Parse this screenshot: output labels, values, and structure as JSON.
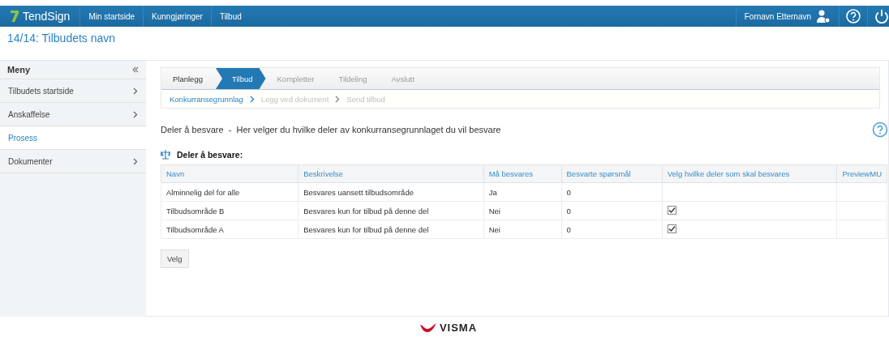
{
  "topbar": {
    "brand": "TendSign",
    "nav": [
      {
        "label": "Min startside",
        "selected": false
      },
      {
        "label": "Kunngjøringer",
        "selected": false
      },
      {
        "label": "Tilbud",
        "selected": false
      }
    ],
    "user": "Fornavn Etternavn"
  },
  "page_title": "14/14: Tilbudets navn",
  "sidebar": {
    "title": "Meny",
    "items": [
      {
        "label": "Tilbudets startside",
        "selected": false,
        "has_submenu": true
      },
      {
        "label": "Anskaffelse",
        "selected": false,
        "has_submenu": true
      },
      {
        "label": "Prosess",
        "selected": true,
        "has_submenu": false
      },
      {
        "label": "Dokumenter",
        "selected": false,
        "has_submenu": true
      }
    ]
  },
  "steps": [
    {
      "label": "Planlegg",
      "selected": false,
      "disabled": false
    },
    {
      "label": "Tilbud",
      "selected": true,
      "disabled": false
    },
    {
      "label": "Kompletter",
      "selected": false,
      "disabled": true
    },
    {
      "label": "Tildeling",
      "selected": false,
      "disabled": true
    },
    {
      "label": "Avslutt",
      "selected": false,
      "disabled": true
    }
  ],
  "substeps": [
    {
      "label": "Konkurransegrunnlag",
      "selected": true
    },
    {
      "label": "Legg ved dokument",
      "selected": false
    },
    {
      "label": "Send tilbud",
      "selected": false
    }
  ],
  "heading": "Deler å besvare  -  Her velger du hvilke deler av konkurransegrunnlaget du vil besvare",
  "section_title": "Deler å besvare:",
  "table": {
    "columns": [
      "Navn",
      "Beskrivelse",
      "Må besvares",
      "Besvarte spørsmål",
      "Velg hvilke deler som skal besvares",
      "PreviewMU"
    ],
    "rows": [
      {
        "name": "Alminnelig del for alle",
        "description": "Besvares uansett tilbudsområde",
        "required": "Ja",
        "answered": "0",
        "choice": {
          "kind": "none"
        }
      },
      {
        "name": "Tilbudsområde B",
        "description": "Besvares kun for tilbud på denne del",
        "required": "Nei",
        "answered": "0",
        "choice": {
          "kind": "checkbox",
          "checked": true
        }
      },
      {
        "name": "Tilbudsområde A",
        "description": "Besvares kun for tilbud på denne del",
        "required": "Nei",
        "answered": "0",
        "choice": {
          "kind": "checkbox",
          "checked": true
        }
      }
    ]
  },
  "button": "Velg",
  "footer": {
    "brand": "VISMA"
  }
}
